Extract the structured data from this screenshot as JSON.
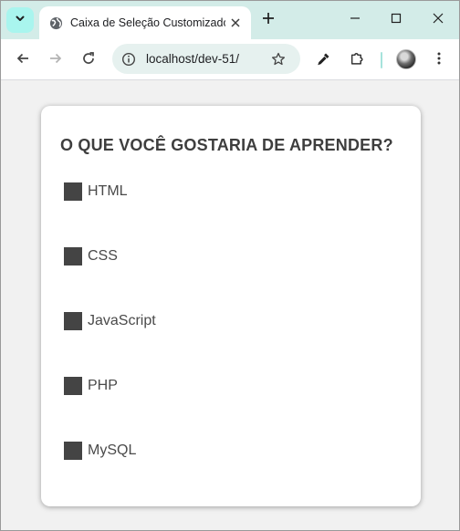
{
  "browser": {
    "tab_title": "Caixa de Seleção Customizado",
    "url": "localhost/dev-51/"
  },
  "icons": {
    "tab_search": "chevron-down-icon",
    "favicon": "globe-icon",
    "tab_close": "close-icon",
    "new_tab": "plus-icon",
    "minimize": "minimize-icon",
    "maximize": "maximize-icon",
    "close": "close-icon",
    "back": "arrow-left-icon",
    "forward": "arrow-right-icon",
    "reload": "reload-icon",
    "site_info": "info-icon",
    "bookmark": "star-icon",
    "eyedropper": "eyedropper-icon",
    "extensions": "puzzle-icon",
    "profile": "avatar",
    "menu": "more-vertical-icon"
  },
  "page": {
    "title": "O QUE VOCÊ GOSTARIA DE APRENDER?",
    "options": [
      {
        "label": "HTML"
      },
      {
        "label": "CSS"
      },
      {
        "label": "JavaScript"
      },
      {
        "label": "PHP"
      },
      {
        "label": "MySQL"
      }
    ]
  },
  "colors": {
    "tabstrip_bg": "#d3ece8",
    "omnibox_bg": "#e6f1ef",
    "checkbox": "#444444",
    "title_text": "#3e3e3e"
  }
}
